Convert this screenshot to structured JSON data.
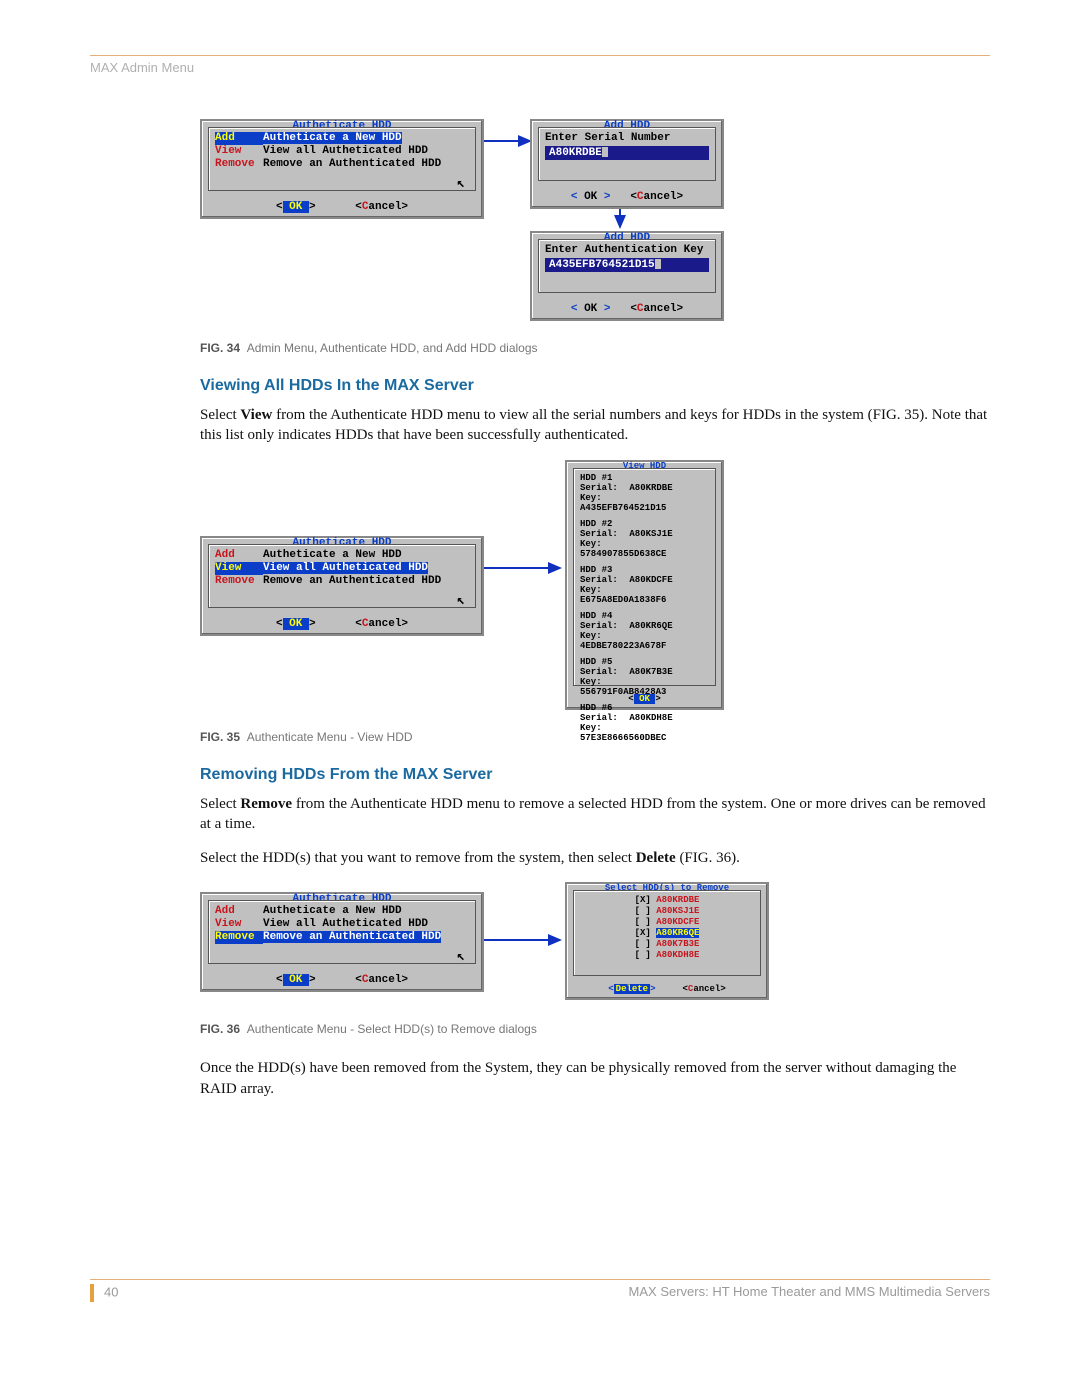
{
  "header": {
    "title": "MAX Admin Menu"
  },
  "fig34": {
    "caption_label": "FIG. 34",
    "caption_text": "Admin Menu, Authenticate HDD, and Add HDD dialogs",
    "auth_dialog": {
      "title": "Autheticate HDD",
      "items": [
        {
          "label": "Add",
          "desc": "Autheticate a New HDD"
        },
        {
          "label": "View",
          "desc": "View all Autheticated HDD"
        },
        {
          "label": "Remove",
          "desc": "Remove an Authenticated HDD"
        }
      ],
      "ok": "OK",
      "cancel": "Cancel"
    },
    "add_serial": {
      "title": "Add HDD",
      "prompt": "Enter Serial Number",
      "value": "A80KRDBE",
      "ok": "OK",
      "cancel": "Cancel"
    },
    "add_key": {
      "title": "Add HDD",
      "prompt": "Enter Authentication Key",
      "value": "A435EFB764521D15",
      "ok": "OK",
      "cancel": "Cancel"
    }
  },
  "section_view": {
    "heading": "Viewing All HDDs In the MAX Server",
    "para_html": "Select <b>View</b> from the Authenticate HDD menu to view all the serial numbers and keys for HDDs in the system (FIG. 35). Note that this list only indicates HDDs that have been successfully authenticated."
  },
  "fig35": {
    "caption_label": "FIG. 35",
    "caption_text": "Authenticate Menu - View HDD",
    "auth_dialog": {
      "title": "Autheticate HDD",
      "items": [
        {
          "label": "Add",
          "desc": "Autheticate a New HDD"
        },
        {
          "label": "View",
          "desc": "View all Autheticated HDD"
        },
        {
          "label": "Remove",
          "desc": "Remove an Authenticated HDD"
        }
      ],
      "ok": "OK",
      "cancel": "Cancel"
    },
    "view_dialog": {
      "title": "View HDD",
      "hdds": [
        {
          "n": "HDD #1",
          "serial": "A80KRDBE",
          "key": "A435EFB764521D15"
        },
        {
          "n": "HDD #2",
          "serial": "A80KSJ1E",
          "key": "5784907855D638CE"
        },
        {
          "n": "HDD #3",
          "serial": "A80KDCFE",
          "key": "E675A8ED0A1838F6"
        },
        {
          "n": "HDD #4",
          "serial": "A80KR6QE",
          "key": "4EDBE780223A678F"
        },
        {
          "n": "HDD #5",
          "serial": "A80K7B3E",
          "key": "556791F0AB8428A3"
        },
        {
          "n": "HDD #6",
          "serial": "A80KDH8E",
          "key": "57E3E8666560DBEC"
        }
      ],
      "ok": "OK"
    }
  },
  "section_remove": {
    "heading": "Removing HDDs From the MAX Server",
    "para1_html": "Select <b>Remove</b> from the Authenticate HDD menu to remove a selected HDD from the system. One or more drives can be removed at a time.",
    "para2_html": "Select the HDD(s) that you want to remove from the system, then select <b>Delete</b> (FIG. 36)."
  },
  "fig36": {
    "caption_label": "FIG. 36",
    "caption_text": "Authenticate Menu - Select HDD(s) to Remove dialogs",
    "auth_dialog": {
      "title": "Autheticate HDD",
      "items": [
        {
          "label": "Add",
          "desc": "Autheticate a New HDD"
        },
        {
          "label": "View",
          "desc": "View all Autheticated HDD"
        },
        {
          "label": "Remove",
          "desc": "Remove an Authenticated HDD"
        }
      ],
      "ok": "OK",
      "cancel": "Cancel"
    },
    "select_dialog": {
      "title": "Select HDD(s) to Remove",
      "rows": [
        {
          "mark": "[X]",
          "serial": "A80KRDBE"
        },
        {
          "mark": "[ ]",
          "serial": "A80KSJ1E"
        },
        {
          "mark": "[ ]",
          "serial": "A80KDCFE"
        },
        {
          "mark": "[X]",
          "serial": "A80KR6QE",
          "sel": true
        },
        {
          "mark": "[ ]",
          "serial": "A80K7B3E"
        },
        {
          "mark": "[ ]",
          "serial": "A80KDH8E"
        }
      ],
      "delete": "Delete",
      "cancel": "Cancel"
    }
  },
  "closing_para": "Once the HDD(s) have been removed from the System, they can be physically removed from the server without damaging the RAID array.",
  "footer": {
    "page": "40",
    "right": "MAX Servers: HT Home Theater and MMS Multimedia Servers"
  }
}
